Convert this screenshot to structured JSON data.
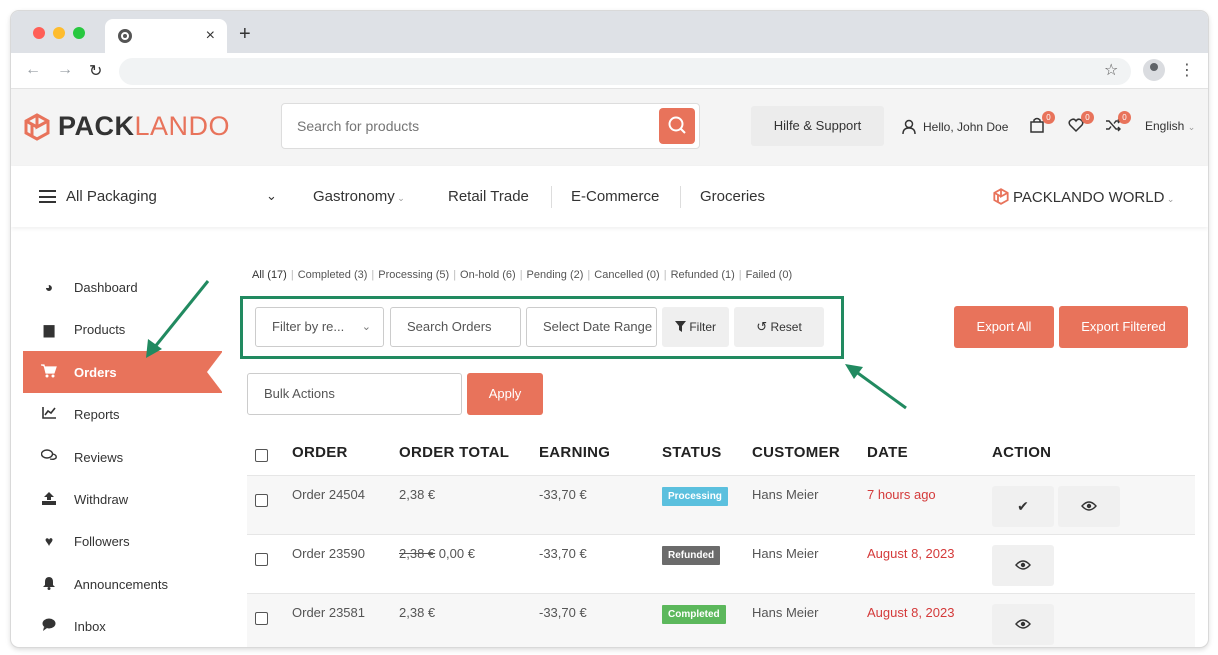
{
  "browser": {
    "tab_close": "×",
    "new_tab": "+",
    "back": "←",
    "forward": "→",
    "reload": "↻",
    "star": "☆",
    "menu": "⋮"
  },
  "header": {
    "logo_part1": "PACK",
    "logo_part2": "LANDO",
    "search_placeholder": "Search for products",
    "help_label": "Hilfe & Support",
    "user_greeting": "Hello, John Doe",
    "cart_count": "0",
    "wishlist_count": "0",
    "compare_count": "0",
    "language": "English"
  },
  "catnav": {
    "all_packaging": "All Packaging",
    "items": [
      "Gastronomy",
      "Retail Trade",
      "E-Commerce",
      "Groceries"
    ],
    "world": "PACKLANDO WORLD"
  },
  "sidebar": {
    "items": [
      {
        "label": "Dashboard",
        "icon": "dashboard-icon"
      },
      {
        "label": "Products",
        "icon": "briefcase-icon"
      },
      {
        "label": "Orders",
        "icon": "cart-icon"
      },
      {
        "label": "Reports",
        "icon": "chart-icon"
      },
      {
        "label": "Reviews",
        "icon": "comments-icon"
      },
      {
        "label": "Withdraw",
        "icon": "upload-icon"
      },
      {
        "label": "Followers",
        "icon": "heart-icon"
      },
      {
        "label": "Announcements",
        "icon": "bell-icon"
      },
      {
        "label": "Inbox",
        "icon": "chat-icon"
      }
    ]
  },
  "status_tabs": [
    "All (17)",
    "Completed (3)",
    "Processing (5)",
    "On-hold (6)",
    "Pending (2)",
    "Cancelled (0)",
    "Refunded (1)",
    "Failed (0)"
  ],
  "filters": {
    "filter_by": "Filter by re...",
    "search_placeholder": "Search Orders",
    "date_placeholder": "Select Date Range",
    "filter_btn": "Filter",
    "reset_btn": "Reset",
    "export_all": "Export All",
    "export_filtered": "Export Filtered",
    "bulk_actions": "Bulk Actions",
    "apply": "Apply"
  },
  "table": {
    "headers": [
      "ORDER",
      "ORDER TOTAL",
      "EARNING",
      "STATUS",
      "CUSTOMER",
      "DATE",
      "ACTION"
    ],
    "rows": [
      {
        "order": "Order 24504",
        "total_old": "",
        "total": "2,38 €",
        "earning": "-33,70 €",
        "status": "Processing",
        "customer": "Hans Meier",
        "date": "7 hours ago"
      },
      {
        "order": "Order 23590",
        "total_old": "2,38 €",
        "total": "0,00 €",
        "earning": "-33,70 €",
        "status": "Refunded",
        "customer": "Hans Meier",
        "date": "August 8, 2023"
      },
      {
        "order": "Order 23581",
        "total_old": "",
        "total": "2,38 €",
        "earning": "-33,70 €",
        "status": "Completed",
        "customer": "Hans Meier",
        "date": "August 8, 2023"
      }
    ]
  },
  "colors": {
    "brand": "#e8735b",
    "annotation": "#218a60",
    "processing": "#5bc0de",
    "refunded": "#6b6b6b",
    "completed": "#5cb85c",
    "date": "#d43a3a"
  }
}
